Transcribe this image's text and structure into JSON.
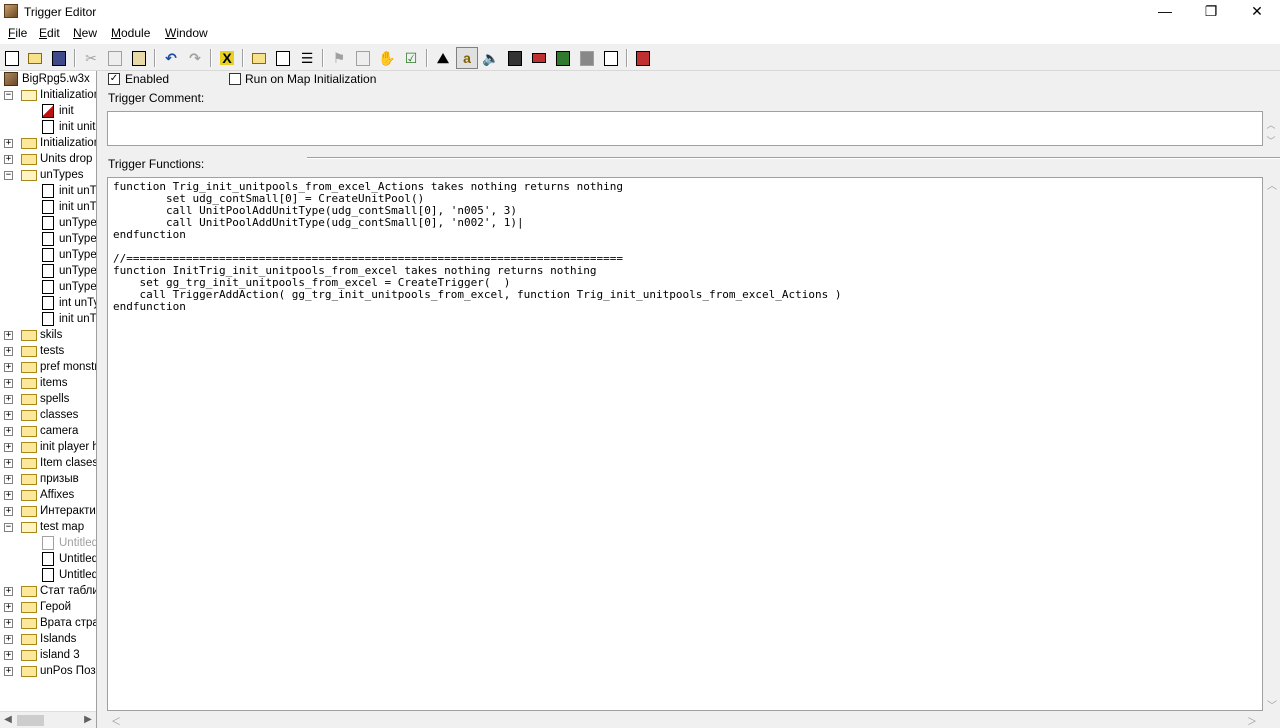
{
  "window": {
    "title": "Trigger Editor",
    "controls": {
      "minimize": "—",
      "maximize": "❐",
      "close": "✕"
    }
  },
  "menu": [
    "File",
    "Edit",
    "New",
    "Module",
    "Window"
  ],
  "toolbar": {
    "buttons": [
      "new-icon",
      "open-folder-icon",
      "save-icon",
      "cut-icon",
      "copy-icon",
      "paste-icon",
      "undo-icon",
      "redo-icon",
      "delete-icon",
      "new-category-icon",
      "new-trigger-icon",
      "new-comment-icon",
      "new-event-icon",
      "new-condition-icon",
      "new-action-icon",
      "test-map-icon",
      "terrain-editor-icon",
      "trigger-editor-icon",
      "sound-editor-icon",
      "object-editor-icon",
      "campaign-editor-icon",
      "ai-editor-icon",
      "object-manager-icon",
      "import-manager-icon",
      "test-map-run-icon"
    ]
  },
  "tree": {
    "map": "BigRpg5.w3x",
    "items": [
      {
        "type": "category",
        "label": "Initialization",
        "expanded": true,
        "level": 0
      },
      {
        "type": "trigger",
        "label": "init",
        "level": 1,
        "state": "error"
      },
      {
        "type": "trigger",
        "label": "init unitp",
        "level": 1,
        "state": "selected"
      },
      {
        "type": "category",
        "label": "Initialization",
        "expanded": false,
        "level": 0
      },
      {
        "type": "category",
        "label": "Units drop",
        "expanded": false,
        "level": 0
      },
      {
        "type": "category",
        "label": "unTypes",
        "expanded": true,
        "level": 0
      },
      {
        "type": "trigger",
        "label": "init unTy",
        "level": 1
      },
      {
        "type": "trigger",
        "label": "init unTy",
        "level": 1
      },
      {
        "type": "trigger",
        "label": "unType",
        "level": 1
      },
      {
        "type": "trigger",
        "label": "unType",
        "level": 1
      },
      {
        "type": "trigger",
        "label": "unType",
        "level": 1
      },
      {
        "type": "trigger",
        "label": "unType",
        "level": 1
      },
      {
        "type": "trigger",
        "label": "unType",
        "level": 1
      },
      {
        "type": "trigger",
        "label": "int unTy",
        "level": 1
      },
      {
        "type": "trigger",
        "label": "init unTy",
        "level": 1
      },
      {
        "type": "category",
        "label": "skils",
        "expanded": false,
        "level": 0
      },
      {
        "type": "category",
        "label": "tests",
        "expanded": false,
        "level": 0
      },
      {
        "type": "category",
        "label": "pref monstrs",
        "expanded": false,
        "level": 0
      },
      {
        "type": "category",
        "label": "items",
        "expanded": false,
        "level": 0
      },
      {
        "type": "category",
        "label": "spells",
        "expanded": false,
        "level": 0
      },
      {
        "type": "category",
        "label": "classes",
        "expanded": false,
        "level": 0
      },
      {
        "type": "category",
        "label": "camera",
        "expanded": false,
        "level": 0
      },
      {
        "type": "category",
        "label": "init player he",
        "expanded": false,
        "level": 0
      },
      {
        "type": "category",
        "label": "Item clases",
        "expanded": false,
        "level": 0
      },
      {
        "type": "category",
        "label": "призыв",
        "expanded": false,
        "level": 0
      },
      {
        "type": "category",
        "label": "Affixes",
        "expanded": false,
        "level": 0
      },
      {
        "type": "category",
        "label": "Интерактив",
        "expanded": false,
        "level": 0
      },
      {
        "type": "category",
        "label": "test map",
        "expanded": true,
        "level": 0
      },
      {
        "type": "trigger",
        "label": "Untitled",
        "level": 1,
        "state": "disabled"
      },
      {
        "type": "trigger",
        "label": "Untitled",
        "level": 1
      },
      {
        "type": "trigger",
        "label": "Untitled",
        "level": 1
      },
      {
        "type": "category",
        "label": "Стат табли",
        "expanded": false,
        "level": 0
      },
      {
        "type": "category",
        "label": "Герой",
        "expanded": false,
        "level": 0
      },
      {
        "type": "category",
        "label": "Врата стра",
        "expanded": false,
        "level": 0
      },
      {
        "type": "category",
        "label": "Islands",
        "expanded": false,
        "level": 0
      },
      {
        "type": "category",
        "label": "island 3",
        "expanded": false,
        "level": 0
      },
      {
        "type": "category",
        "label": "unPos Пози",
        "expanded": false,
        "level": 0
      }
    ]
  },
  "trigger": {
    "enabled_label": "Enabled",
    "enabled": true,
    "run_on_init_label": "Run on Map Initialization",
    "run_on_init": false,
    "comment_label": "Trigger Comment:",
    "comment": "",
    "functions_label": "Trigger Functions:",
    "code": [
      "function Trig_init_unitpools_from_excel_Actions takes nothing returns nothing",
      "        set udg_contSmall[0] = CreateUnitPool()",
      "        call UnitPoolAddUnitType(udg_contSmall[0], 'n005', 3)",
      "        call UnitPoolAddUnitType(udg_contSmall[0], 'n002', 1)|",
      "endfunction",
      "",
      "//===========================================================================",
      "function InitTrig_init_unitpools_from_excel takes nothing returns nothing",
      "    set gg_trg_init_unitpools_from_excel = CreateTrigger(  )",
      "    call TriggerAddAction( gg_trg_init_unitpools_from_excel, function Trig_init_unitpools_from_excel_Actions )",
      "endfunction"
    ]
  }
}
